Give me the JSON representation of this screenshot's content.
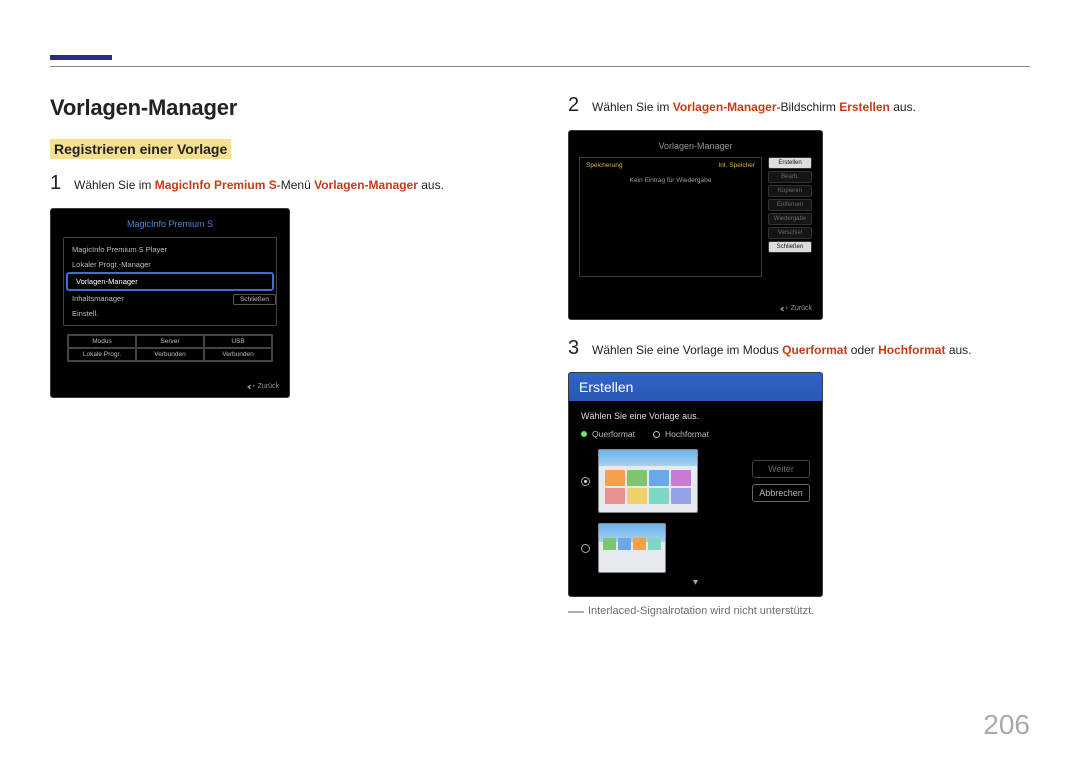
{
  "page_number": "206",
  "heading": "Vorlagen-Manager",
  "section_label": "Registrieren einer Vorlage",
  "step1": {
    "pre": "Wählen Sie im ",
    "em1": "MagicInfo Premium S",
    "mid": "-Menü ",
    "em2": "Vorlagen-Manager",
    "post": " aus."
  },
  "shot1": {
    "title": "MagicInfo Premium S",
    "items": [
      "MagicInfo Premium S Player",
      "Lokaler Progr.-Manager",
      "Vorlagen-Manager",
      "Inhaltsmanager",
      "Einstell."
    ],
    "sub_chip": "Schließen",
    "grid_row1": [
      "Modus",
      "Server",
      "USB"
    ],
    "grid_row2": [
      "Lokale Progr.",
      "Verbunden",
      "Verbunden"
    ],
    "back": "Zurück"
  },
  "step2": {
    "pre": "Wählen Sie im ",
    "em1": "Vorlagen-Manager",
    "mid": "-Bildschirm ",
    "em2": "Erstellen",
    "post": " aus."
  },
  "shot2": {
    "title": "Vorlagen-Manager",
    "tag_left": "Speicherung",
    "tag_right": "Int. Speicher",
    "empty": "Kein Eintrag für Wiedergabe",
    "buttons": [
      "Erstellen",
      "Bearb.",
      "Kopieren",
      "Entfernen",
      "Wiedergabe",
      "Verschiel",
      "Schließen"
    ],
    "back": "Zurück"
  },
  "step3": {
    "pre": "Wählen Sie eine Vorlage im Modus ",
    "em1": "Querformat",
    "mid": " oder ",
    "em2": "Hochformat",
    "post": " aus."
  },
  "shot3": {
    "header": "Erstellen",
    "prompt": "Wählen Sie eine Vorlage aus.",
    "tab1": "Querformat",
    "tab2": "Hochformat",
    "thumb_caption": "",
    "action_next": "Weiter",
    "action_cancel": "Abbrechen"
  },
  "footnote": "Interlaced-Signalrotation wird nicht unterstützt."
}
